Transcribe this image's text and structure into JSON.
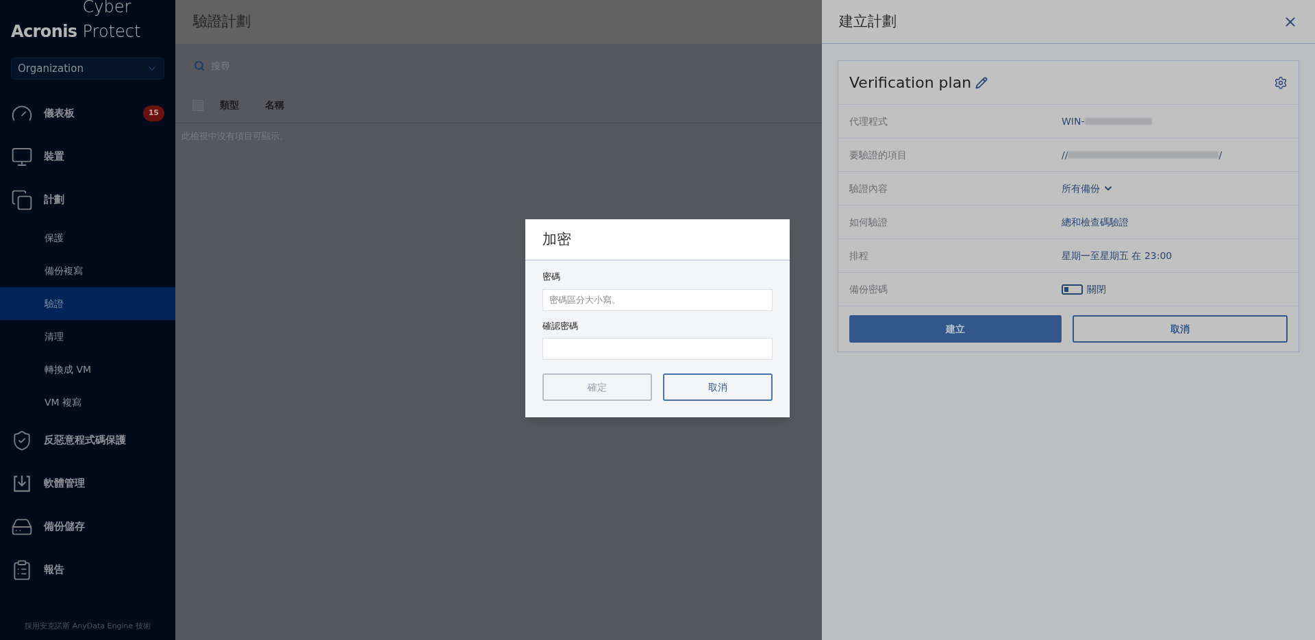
{
  "sidebar": {
    "logo": {
      "brand": "Acronis",
      "product": "Cyber Protect"
    },
    "org_selector": "Organization",
    "items": [
      {
        "label": "儀表板",
        "kind": "main",
        "badge": "15",
        "selected": false
      },
      {
        "label": "裝置",
        "kind": "main",
        "selected": false
      },
      {
        "label": "計劃",
        "kind": "main",
        "selected": false
      },
      {
        "label": "保護",
        "kind": "sub",
        "selected": false
      },
      {
        "label": "備份複寫",
        "kind": "sub",
        "selected": false
      },
      {
        "label": "驗證",
        "kind": "sub",
        "selected": true
      },
      {
        "label": "清理",
        "kind": "sub",
        "selected": false
      },
      {
        "label": "轉換成 VM",
        "kind": "sub",
        "selected": false
      },
      {
        "label": "VM 複寫",
        "kind": "sub",
        "selected": false
      },
      {
        "label": "反惡意程式碼保護",
        "kind": "main",
        "selected": false
      },
      {
        "label": "軟體管理",
        "kind": "main",
        "selected": false
      },
      {
        "label": "備份儲存",
        "kind": "main",
        "selected": false
      },
      {
        "label": "報告",
        "kind": "main",
        "selected": false
      }
    ],
    "footer": "採用安克諾斯 AnyData Engine 技術"
  },
  "main": {
    "title": "驗證計劃",
    "search": {
      "placeholder": "搜尋"
    },
    "select_all": {
      "checked": false
    },
    "columns": [
      "類型",
      "名稱"
    ],
    "empty_message": "此檢視中沒有項目可顯示。"
  },
  "panel": {
    "title": "建立計劃",
    "plan_name": "Verification plan",
    "rows": [
      {
        "label": "代理程式",
        "kind": "redacted",
        "prefix": "WIN-"
      },
      {
        "label": "要驗證的項目",
        "kind": "redacted",
        "prefix": "//",
        "suffix": "/"
      },
      {
        "label": "驗證內容",
        "kind": "dropdown",
        "value": "所有備份"
      },
      {
        "label": "如何驗證",
        "kind": "text",
        "value": "總和檢查碼驗證"
      },
      {
        "label": "排程",
        "kind": "text",
        "value": "星期一至星期五 在 23:00"
      },
      {
        "label": "備份密碼",
        "kind": "toggle",
        "on": false,
        "value": "關閉"
      }
    ],
    "buttons": [
      {
        "label": "建立",
        "kind": "primary"
      },
      {
        "label": "取消",
        "kind": "secondary"
      }
    ]
  },
  "dialog": {
    "title": "加密",
    "fields": [
      {
        "label": "密碼",
        "placeholder": "密碼區分大小寫。"
      },
      {
        "label": "確認密碼"
      }
    ],
    "buttons": [
      {
        "label": "確定",
        "disabled": true
      },
      {
        "label": "取消",
        "disabled": false
      }
    ]
  }
}
